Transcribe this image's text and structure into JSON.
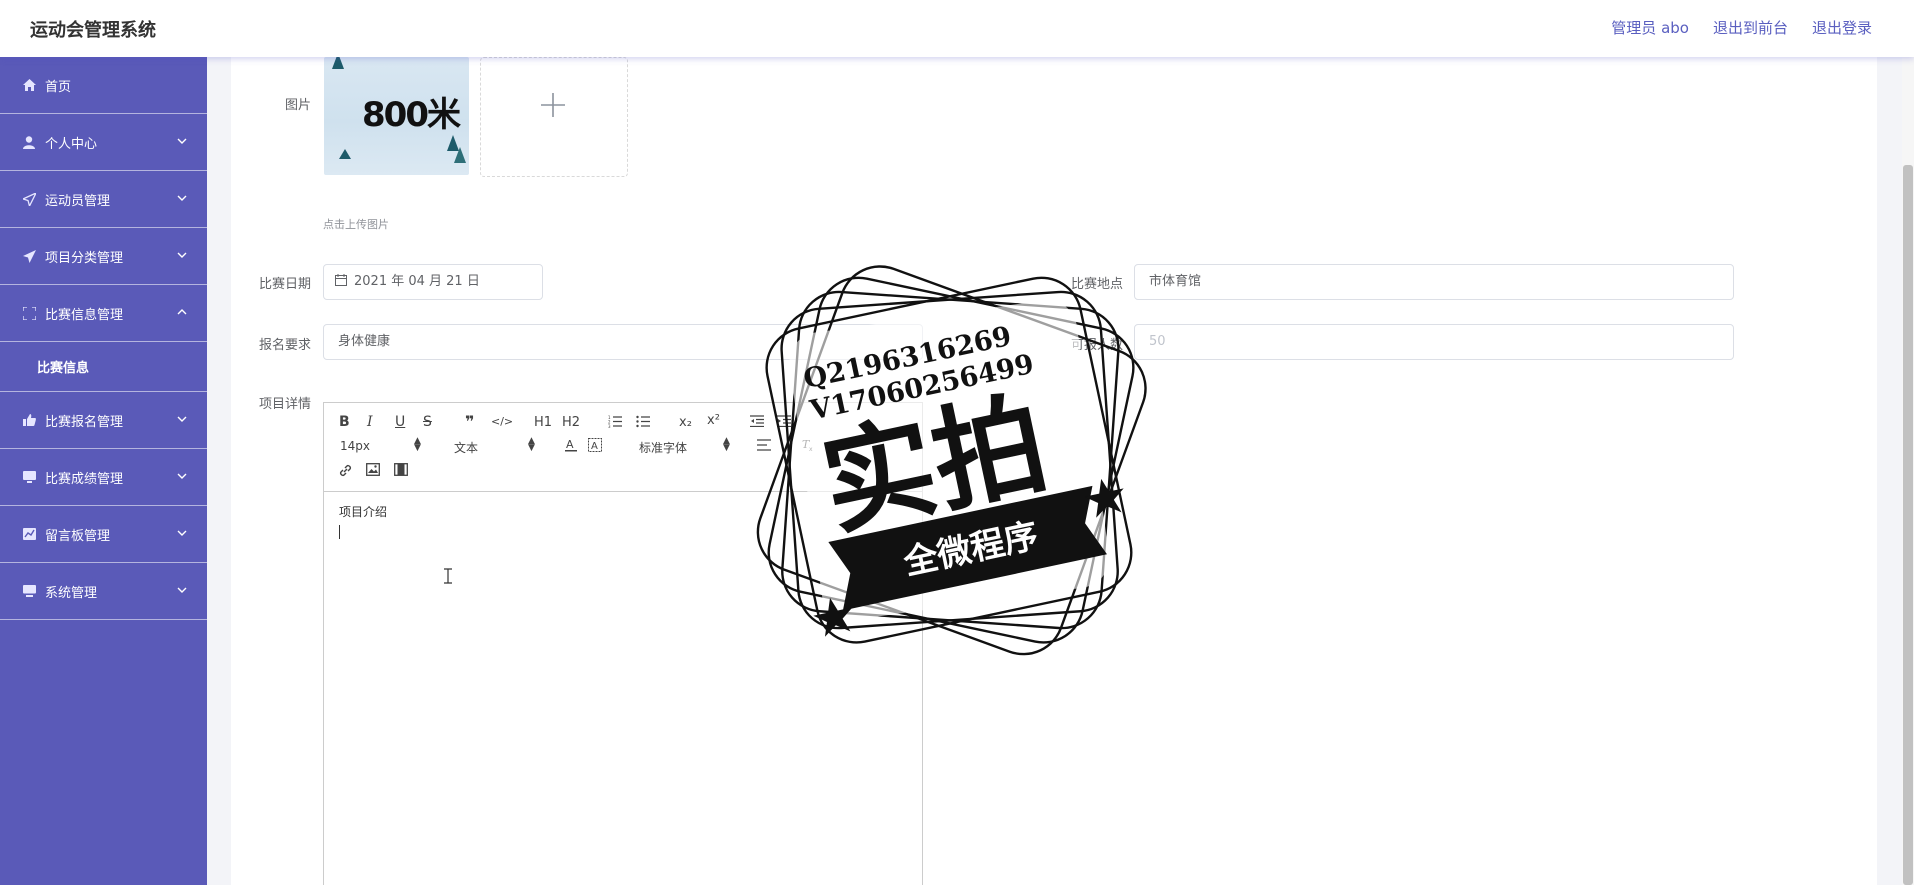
{
  "header": {
    "app_title": "运动会管理系统",
    "admin_label": "管理员 abo",
    "to_front_link": "退出到前台",
    "logout_link": "退出登录"
  },
  "sidebar": {
    "items": [
      {
        "label": "首页",
        "icon": "home-icon"
      },
      {
        "label": "个人中心",
        "icon": "user-icon"
      },
      {
        "label": "运动员管理",
        "icon": "send-icon"
      },
      {
        "label": "项目分类管理",
        "icon": "paper-plane-icon"
      },
      {
        "label": "比赛信息管理",
        "icon": "fullscreen-icon"
      },
      {
        "label": "比赛信息",
        "icon": ""
      },
      {
        "label": "比赛报名管理",
        "icon": "thumb-up-icon"
      },
      {
        "label": "比赛成绩管理",
        "icon": "monitor-icon"
      },
      {
        "label": "留言板管理",
        "icon": "chart-icon"
      },
      {
        "label": "系统管理",
        "icon": "desktop-icon"
      }
    ]
  },
  "form": {
    "image_label": "图片",
    "image_caption": "800米",
    "upload_hint": "点击上传图片",
    "date_label": "比赛日期",
    "date_value": "2021 年 04 月 21 日",
    "location_label": "比赛地点",
    "location_value": "市体育馆",
    "requirement_label": "报名要求",
    "requirement_value": "身体健康",
    "capacity_label": "可报人数",
    "capacity_value": "50",
    "details_label": "项目详情"
  },
  "editor": {
    "toolbar_row1": [
      "B",
      "I",
      "U",
      "S",
      "❞",
      "</>",
      "H1",
      "H2",
      "ordered-list",
      "bullet-list",
      "x₂",
      "x²",
      "outdent",
      "indent"
    ],
    "font_size": "14px",
    "header_select": "文本",
    "font_family": "标准字体",
    "content": "项目介绍"
  },
  "watermark": {
    "qq": "Q2196316269",
    "vx": "V17060256499",
    "big_text": "实拍",
    "banner_text": "全微程序"
  }
}
